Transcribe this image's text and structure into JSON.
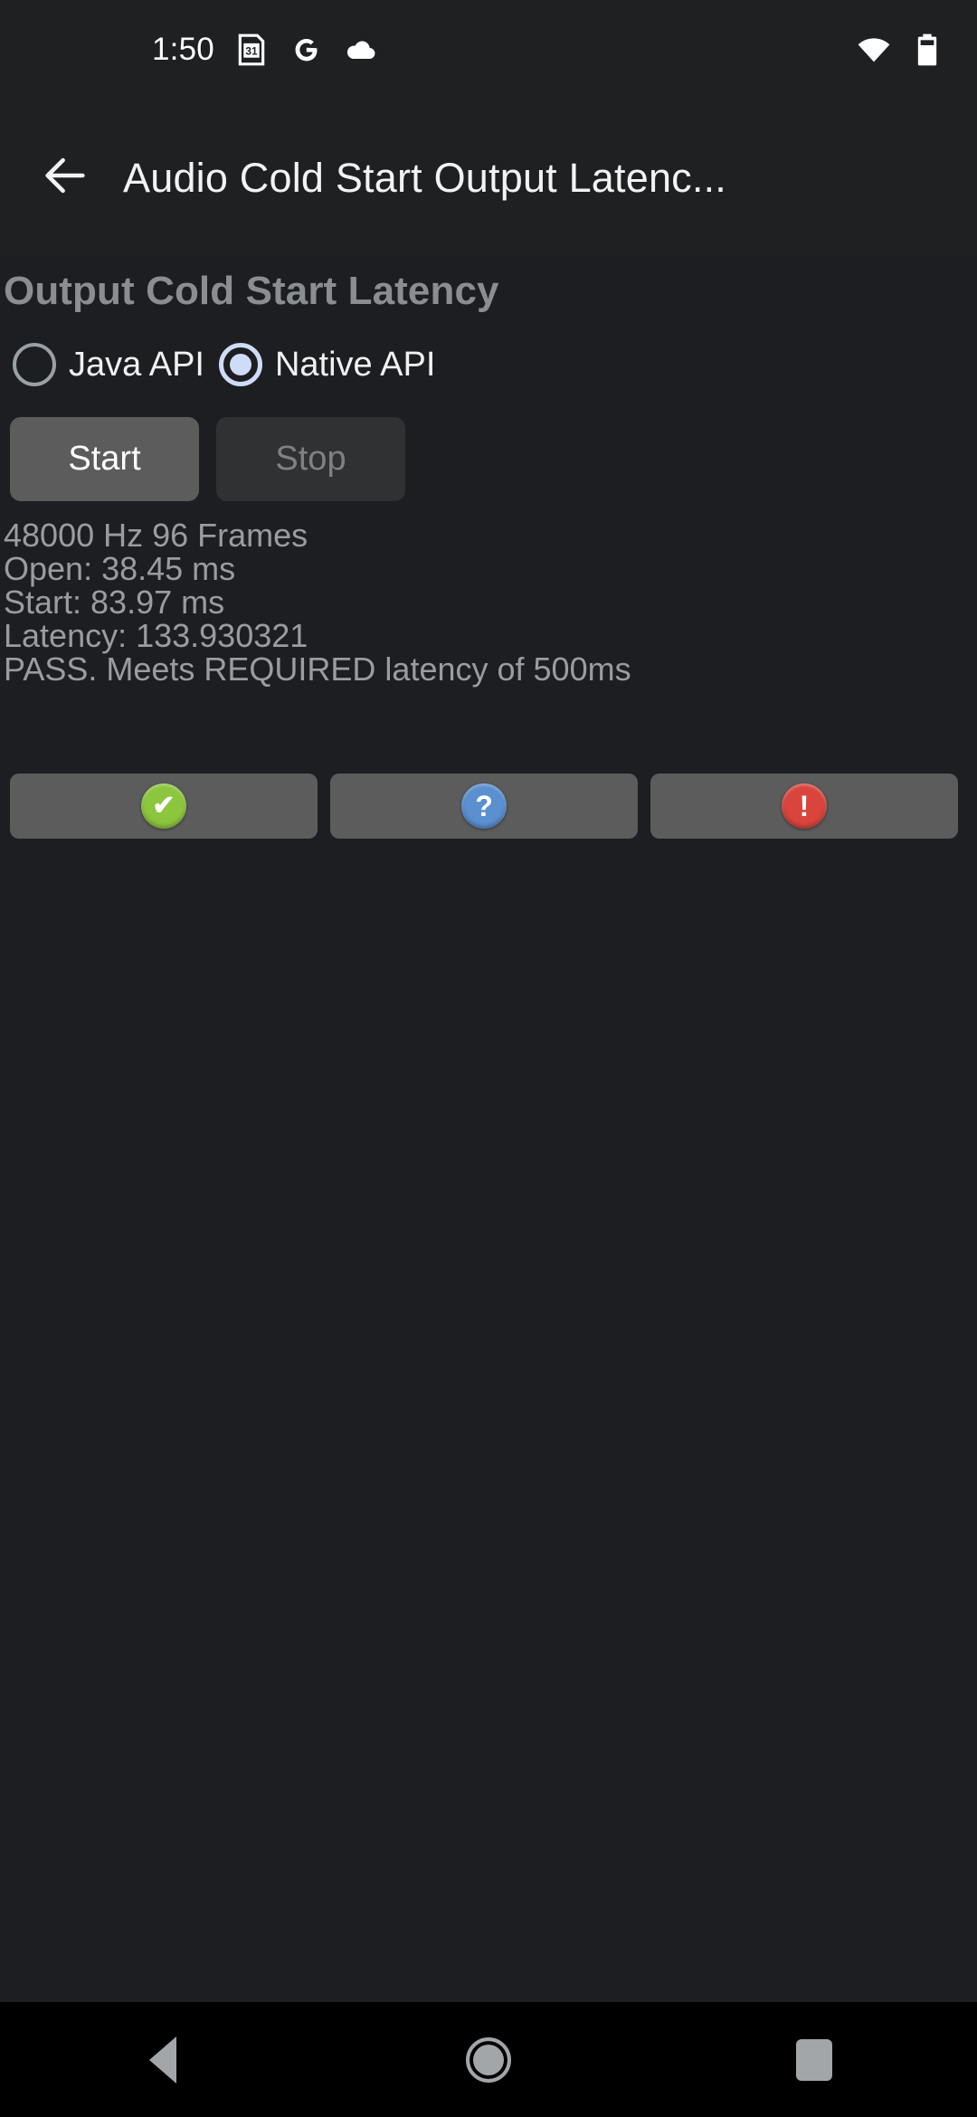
{
  "status_bar": {
    "time": "1:50",
    "left_icons": [
      "calendar-31-icon",
      "google-g-icon",
      "cloud-icon"
    ],
    "calendar_day": "31",
    "google_letter": "G",
    "right_icons": [
      "wifi-icon",
      "battery-icon"
    ]
  },
  "app_bar": {
    "back_icon": "back-arrow-icon",
    "title": "Audio Cold Start Output Latenc..."
  },
  "main": {
    "heading": "Output Cold Start Latency",
    "radio_group": {
      "options": [
        {
          "label": "Java API",
          "selected": false
        },
        {
          "label": "Native API",
          "selected": true
        }
      ]
    },
    "buttons": [
      {
        "label": "Start",
        "enabled": true
      },
      {
        "label": "Stop",
        "enabled": false
      }
    ],
    "results": [
      "48000 Hz 96 Frames",
      "Open: 38.45 ms",
      "Start: 83.97 ms",
      "Latency: 133.930321",
      "PASS. Meets REQUIRED latency of 500ms"
    ],
    "verdict_buttons": [
      {
        "icon": "pass-check-icon",
        "glyph": "✔",
        "color": "#8cc63e"
      },
      {
        "icon": "info-question-icon",
        "glyph": "?",
        "color": "#5a8fd0"
      },
      {
        "icon": "fail-exclaim-icon",
        "glyph": "!",
        "color": "#d9453c"
      }
    ]
  },
  "nav_bar": {
    "items": [
      "back-triangle-icon",
      "home-circle-icon",
      "recents-square-icon"
    ]
  },
  "colors": {
    "background": "#1c1e21",
    "app_bar": "#1e2022",
    "accent": "#cfdcf7",
    "button_enabled": "#5c5c5c",
    "button_disabled": "#2f3133",
    "text_muted": "#9a9da0"
  }
}
